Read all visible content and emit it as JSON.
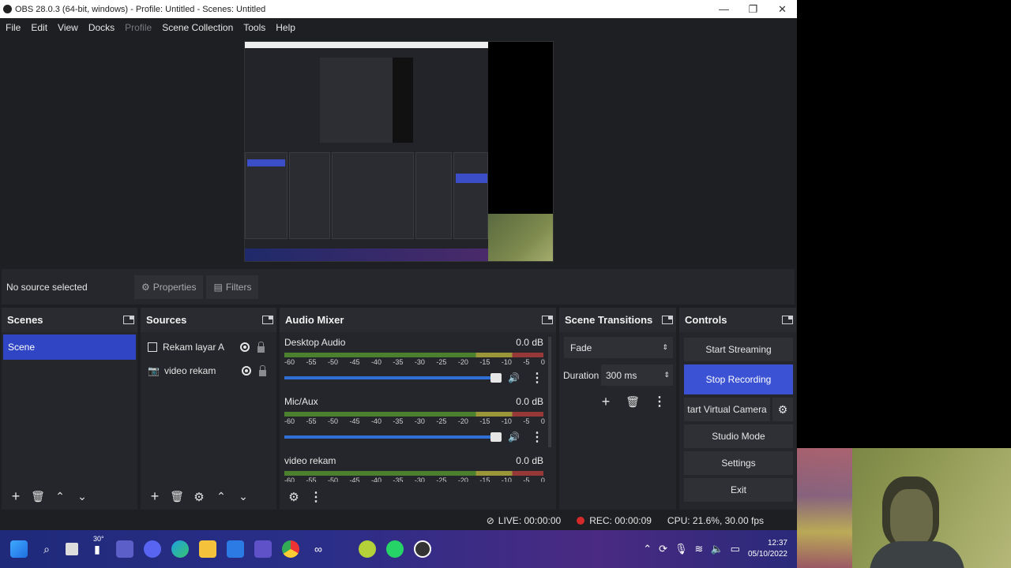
{
  "window": {
    "title": "OBS 28.0.3 (64-bit, windows) - Profile: Untitled - Scenes: Untitled",
    "minimize": "—",
    "maximize": "❐",
    "close": "✕"
  },
  "menu": [
    "File",
    "Edit",
    "View",
    "Docks",
    "Profile",
    "Scene Collection",
    "Tools",
    "Help"
  ],
  "source_toolbar": {
    "no_source": "No source selected",
    "properties": "Properties",
    "filters": "Filters"
  },
  "scenes": {
    "title": "Scenes",
    "items": [
      "Scene"
    ]
  },
  "sources": {
    "title": "Sources",
    "items": [
      {
        "label": "Rekam layar A",
        "icon": "display-checkbox-icon"
      },
      {
        "label": "video rekam",
        "icon": "camera-icon"
      }
    ]
  },
  "mixer": {
    "title": "Audio Mixer",
    "ticks": [
      "-60",
      "-55",
      "-50",
      "-45",
      "-40",
      "-35",
      "-30",
      "-25",
      "-20",
      "-15",
      "-10",
      "-5",
      "0"
    ],
    "channels": [
      {
        "name": "Desktop Audio",
        "db": "0.0 dB"
      },
      {
        "name": "Mic/Aux",
        "db": "0.0 dB"
      },
      {
        "name": "video rekam",
        "db": "0.0 dB"
      }
    ]
  },
  "transitions": {
    "title": "Scene Transitions",
    "selected": "Fade",
    "duration_label": "Duration",
    "duration_value": "300 ms"
  },
  "controls": {
    "title": "Controls",
    "start_streaming": "Start Streaming",
    "stop_recording": "Stop Recording",
    "start_virtual_camera": "tart Virtual Camera",
    "studio_mode": "Studio Mode",
    "settings": "Settings",
    "exit": "Exit"
  },
  "status": {
    "live": "LIVE: 00:00:00",
    "rec": "REC: 00:00:09",
    "cpu": "CPU: 21.6%, 30.00 fps"
  },
  "taskbar": {
    "weather": "30°",
    "time": "12:37",
    "date": "05/10/2022"
  },
  "colors": {
    "accent": "#3b52d4",
    "rec": "#d42a2a"
  }
}
